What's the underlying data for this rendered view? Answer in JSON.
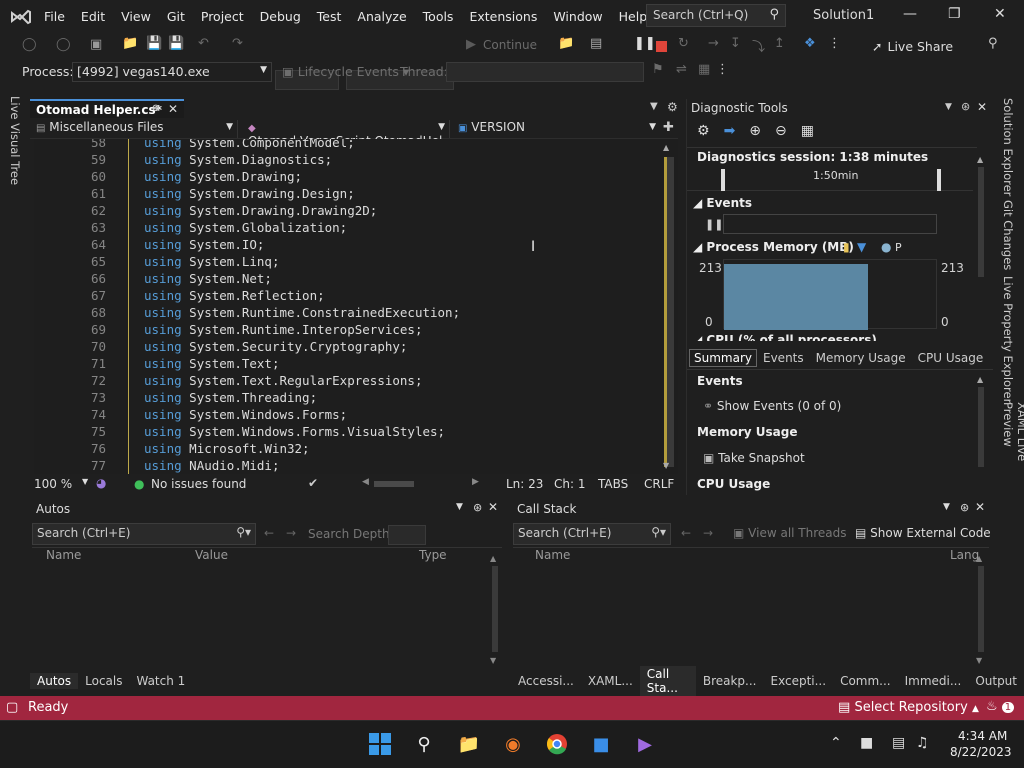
{
  "menu": [
    "File",
    "Edit",
    "View",
    "Git",
    "Project",
    "Debug",
    "Test",
    "Analyze",
    "Tools",
    "Extensions",
    "Window",
    "Help"
  ],
  "search": {
    "placeholder": "Search (Ctrl+Q)"
  },
  "solution_title": "Solution1",
  "toolbar": {
    "continue_label": "Continue",
    "live_share_label": "Live Share"
  },
  "process": {
    "label": "Process:",
    "value": "[4992] vegas140.exe",
    "lifecycle_label": "Lifecycle Events",
    "thread_label": "Thread:"
  },
  "left_sidebar": {
    "live_visual_tree": "Live Visual Tree"
  },
  "right_sidebar": [
    "Solution Explorer",
    "Git Changes",
    "Live Property Explorer",
    "XAML Live Preview"
  ],
  "editor": {
    "tab_title": "Otomad Helper.cs*",
    "nav_scope": "Miscellaneous Files",
    "nav_class": "Otomad.VegasScript.OtomadHel",
    "nav_member": "VERSION",
    "lines": [
      {
        "n": "58",
        "kw": "using",
        "ns": "System.ComponentModel;"
      },
      {
        "n": "59",
        "kw": "using",
        "ns": "System.Diagnostics;"
      },
      {
        "n": "60",
        "kw": "using",
        "ns": "System.Drawing;"
      },
      {
        "n": "61",
        "kw": "using",
        "ns": "System.Drawing.Design;"
      },
      {
        "n": "62",
        "kw": "using",
        "ns": "System.Drawing.Drawing2D;"
      },
      {
        "n": "63",
        "kw": "using",
        "ns": "System.Globalization;"
      },
      {
        "n": "64",
        "kw": "using",
        "ns": "System.IO;"
      },
      {
        "n": "65",
        "kw": "using",
        "ns": "System.Linq;"
      },
      {
        "n": "66",
        "kw": "using",
        "ns": "System.Net;"
      },
      {
        "n": "67",
        "kw": "using",
        "ns": "System.Reflection;"
      },
      {
        "n": "68",
        "kw": "using",
        "ns": "System.Runtime.ConstrainedExecution;"
      },
      {
        "n": "69",
        "kw": "using",
        "ns": "System.Runtime.InteropServices;"
      },
      {
        "n": "70",
        "kw": "using",
        "ns": "System.Security.Cryptography;"
      },
      {
        "n": "71",
        "kw": "using",
        "ns": "System.Text;"
      },
      {
        "n": "72",
        "kw": "using",
        "ns": "System.Text.RegularExpressions;"
      },
      {
        "n": "73",
        "kw": "using",
        "ns": "System.Threading;"
      },
      {
        "n": "74",
        "kw": "using",
        "ns": "System.Windows.Forms;"
      },
      {
        "n": "75",
        "kw": "using",
        "ns": "System.Windows.Forms.VisualStyles;"
      },
      {
        "n": "76",
        "kw": "using",
        "ns": "Microsoft.Win32;"
      },
      {
        "n": "77",
        "kw": "using",
        "ns": "NAudio.Midi;"
      }
    ]
  },
  "editor_status": {
    "zoom": "100 %",
    "issues": "No issues found",
    "ln": "Ln: 23",
    "ch": "Ch: 1",
    "tabs": "TABS",
    "eol": "CRLF"
  },
  "diagnostics": {
    "title": "Diagnostic Tools",
    "session": "Diagnostics session: 1:38 minutes",
    "timeline_label": "1:50min",
    "events_label": "Events",
    "memory_label": "Process Memory (MB)",
    "memory_legend": "P",
    "mem_max": "213",
    "mem_min": "0",
    "cpu_label": "CPU (% of all processors)",
    "tabs": [
      "Summary",
      "Events",
      "Memory Usage",
      "CPU Usage"
    ],
    "section_events": "Events",
    "show_events": "Show Events (0 of 0)",
    "section_memory": "Memory Usage",
    "take_snapshot": "Take Snapshot",
    "section_cpu": "CPU Usage"
  },
  "autos": {
    "title": "Autos",
    "search_placeholder": "Search (Ctrl+E)",
    "search_depth": "Search Depth:",
    "columns": [
      "Name",
      "Value",
      "Type"
    ],
    "tabs": [
      "Autos",
      "Locals",
      "Watch 1"
    ]
  },
  "callstack": {
    "title": "Call Stack",
    "search_placeholder": "Search (Ctrl+E)",
    "view_all_threads": "View all Threads",
    "show_external": "Show External Code",
    "columns": [
      "Name",
      "Lang"
    ],
    "tabs": [
      "Accessi...",
      "XAML...",
      "Call Sta...",
      "Breakp...",
      "Excepti...",
      "Comm...",
      "Immedi...",
      "Output"
    ]
  },
  "statusbar": {
    "ready": "Ready",
    "select_repo": "Select Repository",
    "notif_count": "1"
  },
  "taskbar": {
    "time": "4:34 AM",
    "date": "8/22/2023"
  },
  "colors": {
    "accent": "#4a90d9",
    "status_bar": "#a1263f",
    "keyword": "#569cd6",
    "memory_fill": "#5b87a3"
  }
}
